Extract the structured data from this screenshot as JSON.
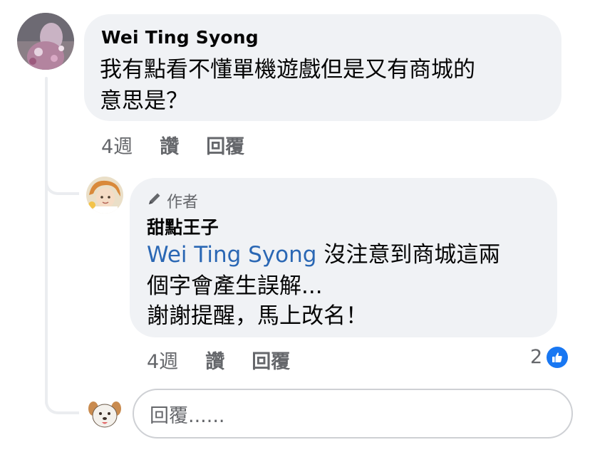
{
  "comment": {
    "author": "Wei Ting Syong",
    "text_line1": "我有點看不懂單機遊戲但是又有商城的",
    "text_line2": "意思是？",
    "time": "4週",
    "like_label": "讚",
    "reply_label": "回覆"
  },
  "reply": {
    "badge_label": "作者",
    "author": "甜點王子",
    "mention": "Wei Ting Syong",
    "text_line1_rest": " 沒注意到商城這兩",
    "text_line2": "個字會產生誤解...",
    "text_line3": "謝謝提醒，馬上改名！",
    "time": "4週",
    "like_label": "讚",
    "reply_label": "回覆",
    "reaction_count": "2"
  },
  "reply_box": {
    "placeholder": "回覆......"
  },
  "icons": {
    "author_badge": "pencil-icon",
    "reaction": "thumbs-up-icon"
  },
  "colors": {
    "bubble": "#f0f2f5",
    "mention": "#2a67b4",
    "secondary_text": "#65676b",
    "like_blue": "#1877f2"
  }
}
